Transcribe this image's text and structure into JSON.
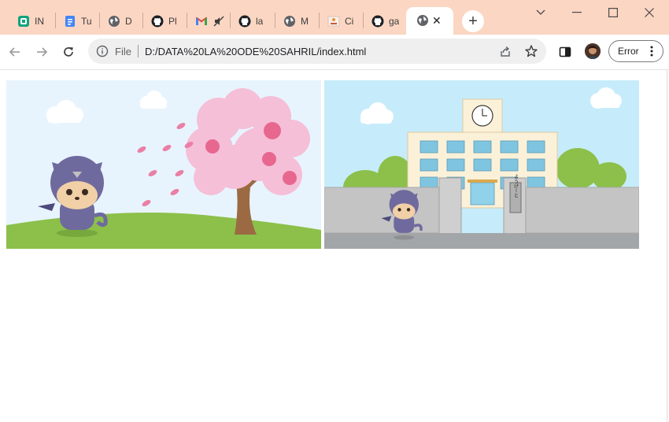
{
  "browser": {
    "tabs": [
      {
        "title": "IN",
        "icon": "app-icon"
      },
      {
        "title": "Tu",
        "icon": "docs-icon"
      },
      {
        "title": "D",
        "icon": "globe-icon"
      },
      {
        "title": "Pl",
        "icon": "github-icon"
      },
      {
        "title": "",
        "icon": "gmail-icon"
      },
      {
        "title": "la",
        "icon": "github-icon"
      },
      {
        "title": "M",
        "icon": "globe-icon"
      },
      {
        "title": "Ci",
        "icon": "image-icon"
      },
      {
        "title": "ga",
        "icon": "github-icon"
      }
    ],
    "active_tab": {
      "icon": "globe-icon",
      "close": "✕"
    },
    "new_tab": "+",
    "window_controls": {
      "dropdown": "⌄",
      "minimize": "—",
      "maximize": "☐",
      "close": "✕"
    }
  },
  "toolbar": {
    "back": "←",
    "forward": "→",
    "reload": "↻",
    "scheme_label": "File",
    "url": "D:/DATA%20LA%20ODE%20SAHRIL/index.html",
    "error_label": "Error"
  },
  "content": {
    "scenes": [
      {
        "name": "cherry-blossom-scene",
        "colors": {
          "sky": "#e8f4fd",
          "grass": "#8cc04a",
          "blossom": "#f5bfd8",
          "trunk": "#9b6a43"
        }
      },
      {
        "name": "school-scene",
        "colors": {
          "sky": "#c6ecfb",
          "wall": "#c4c4c4",
          "building": "#fbf1d8",
          "windows": "#7fc5e0"
        }
      }
    ],
    "school_gate_sign": "ようげーと"
  }
}
